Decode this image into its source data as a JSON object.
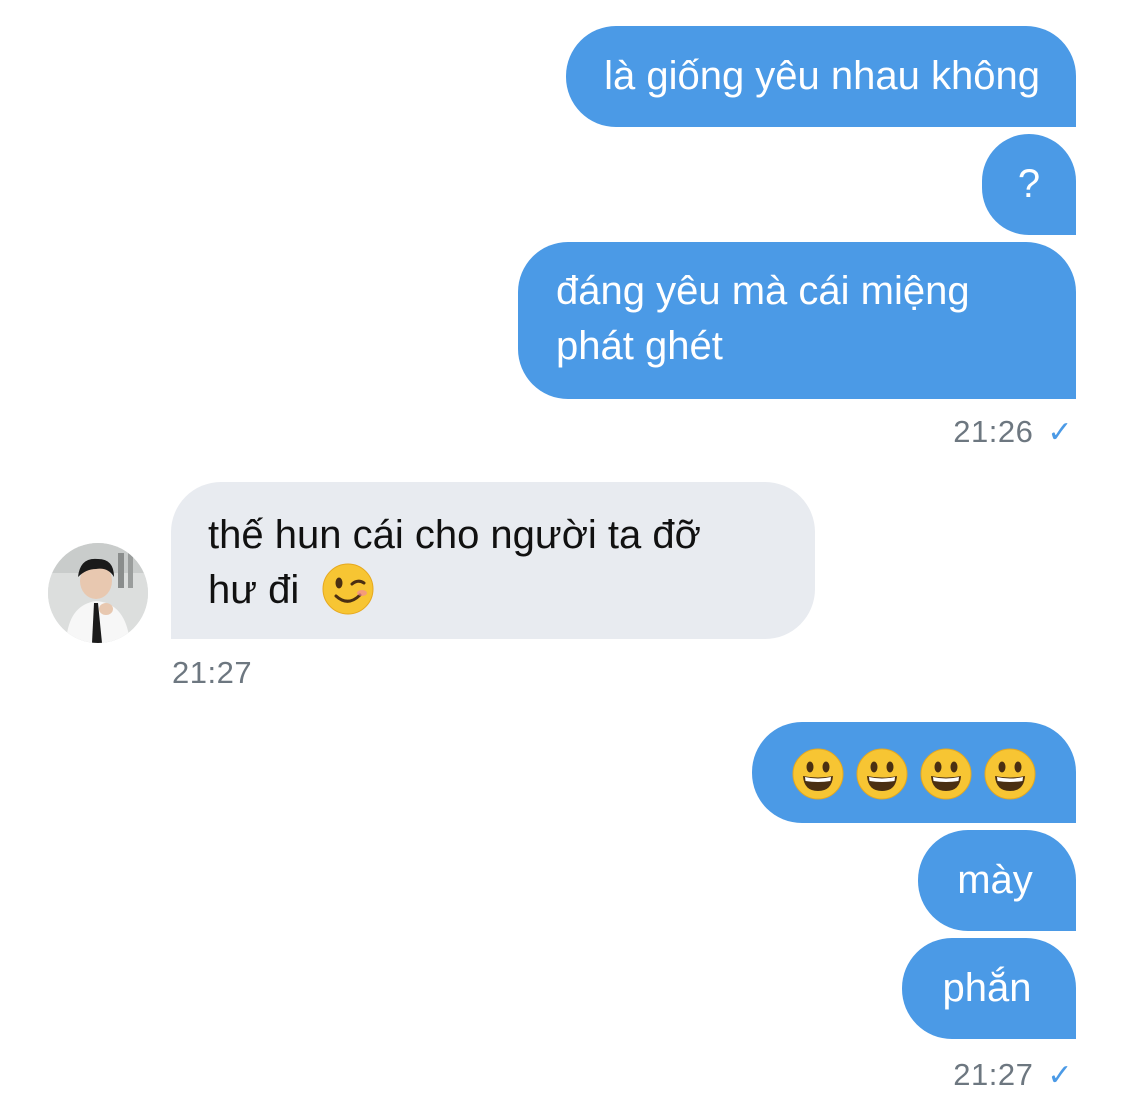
{
  "messages": [
    {
      "side": "sent",
      "text": "là giống yêu nhau không"
    },
    {
      "side": "sent",
      "text": "?"
    },
    {
      "side": "sent",
      "line1": "đáng yêu mà cái miệng",
      "line2": "phát ghét"
    },
    {
      "side": "recv",
      "line1": "thế hun cái cho người ta đỡ",
      "line2": "hư đi",
      "emoji": "winking-face"
    },
    {
      "side": "sent",
      "emoji": "grinning-face",
      "emoji_count": 4
    },
    {
      "side": "sent",
      "text": "mày"
    },
    {
      "side": "sent",
      "text": "phắn"
    }
  ],
  "timestamps": {
    "group1": "21:26",
    "group2": "21:27",
    "group3": "21:27"
  },
  "read_mark": "✓",
  "colors": {
    "sent_bubble": "#4b9ae6",
    "received_bubble": "#e8ebf0",
    "timestamp": "#6d7780",
    "emoji_yellow": "#f7c533"
  },
  "avatar": {
    "icon": "contact-photo-avatar"
  }
}
